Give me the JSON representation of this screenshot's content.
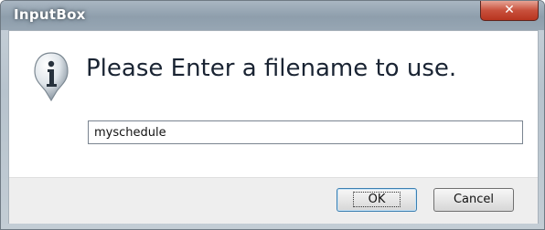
{
  "window": {
    "title": "InputBox",
    "close_glyph": "✕"
  },
  "dialog": {
    "icon": "info-icon",
    "prompt": "Please Enter a filename to use.",
    "filename_value": "myschedule"
  },
  "buttons": {
    "ok_label": "OK",
    "cancel_label": "Cancel"
  },
  "colors": {
    "titlebar": "#97a6b3",
    "close_button": "#c8503c",
    "ok_focus_border": "#3c7fb1"
  }
}
